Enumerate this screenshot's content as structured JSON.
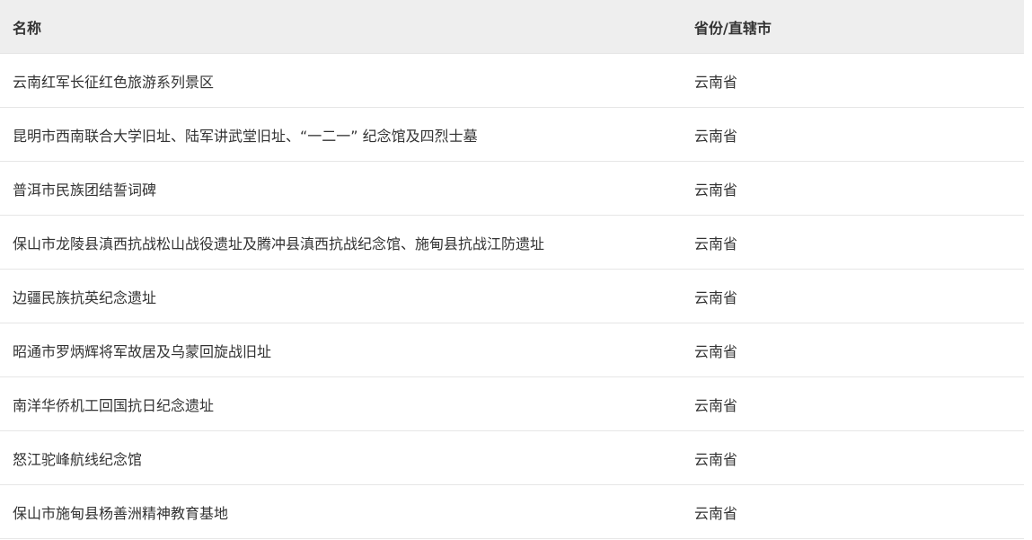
{
  "table": {
    "headers": {
      "name": "名称",
      "province": "省份/直辖市"
    },
    "rows": [
      {
        "name": "云南红军长征红色旅游系列景区",
        "province": "云南省"
      },
      {
        "name": "昆明市西南联合大学旧址、陆军讲武堂旧址、“一二一” 纪念馆及四烈士墓",
        "province": "云南省"
      },
      {
        "name": "普洱市民族团结誓词碑",
        "province": "云南省"
      },
      {
        "name": "保山市龙陵县滇西抗战松山战役遗址及腾冲县滇西抗战纪念馆、施甸县抗战江防遗址",
        "province": "云南省"
      },
      {
        "name": "边疆民族抗英纪念遗址",
        "province": "云南省"
      },
      {
        "name": "昭通市罗炳辉将军故居及乌蒙回旋战旧址",
        "province": "云南省"
      },
      {
        "name": "南洋华侨机工回国抗日纪念遗址",
        "province": "云南省"
      },
      {
        "name": "怒江驼峰航线纪念馆",
        "province": "云南省"
      },
      {
        "name": "保山市施甸县杨善洲精神教育基地",
        "province": "云南省"
      }
    ]
  }
}
